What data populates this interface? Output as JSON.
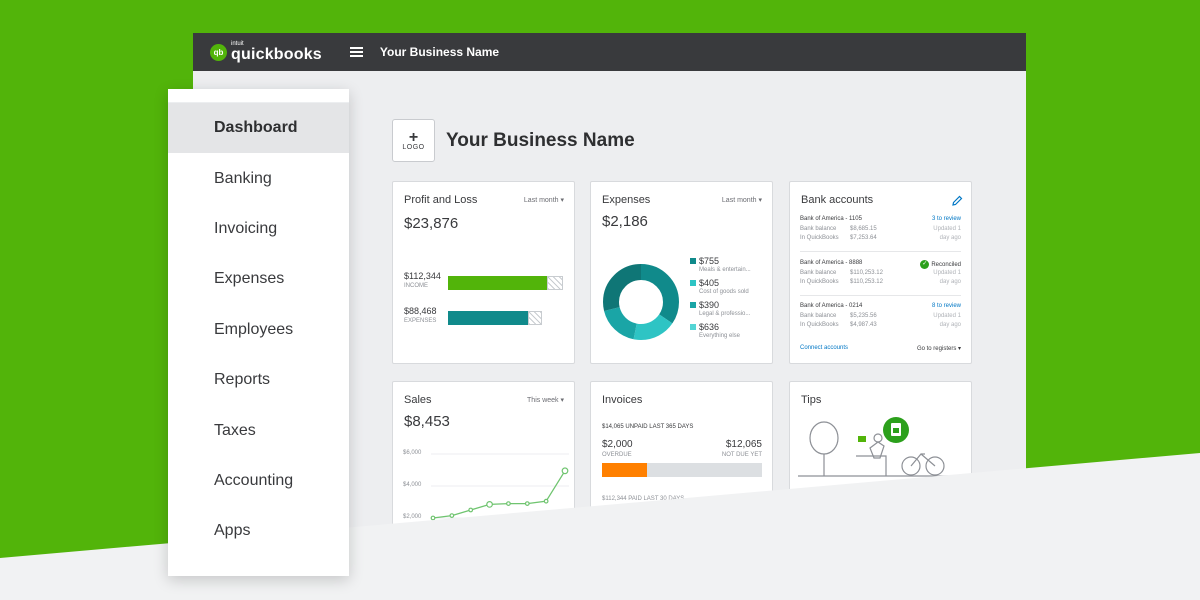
{
  "colors": {
    "brand_green": "#52b40a",
    "dark": "#393a3d",
    "teal": "#108a8b",
    "light_teal": "#2ec4c4",
    "orange": "#ff8000",
    "link_blue": "#0077c5"
  },
  "topbar": {
    "brand_small": "intuit",
    "brand": "quickbooks",
    "logo_icon": "qb",
    "company": "Your Business Name"
  },
  "header": {
    "logo_plus": "+",
    "logo_label": "LOGO",
    "business_name": "Your Business Name"
  },
  "sidebar": {
    "items": [
      {
        "label": "Dashboard",
        "active": true
      },
      {
        "label": "Banking"
      },
      {
        "label": "Invoicing"
      },
      {
        "label": "Expenses"
      },
      {
        "label": "Employees"
      },
      {
        "label": "Reports"
      },
      {
        "label": "Taxes"
      },
      {
        "label": "Accounting"
      },
      {
        "label": "Apps"
      }
    ]
  },
  "profit_loss": {
    "title": "Profit and Loss",
    "period": "Last month ▾",
    "amount": "$23,876",
    "income_value": "$112,344",
    "income_label": "INCOME",
    "expenses_value": "$88,468",
    "expenses_label": "EXPENSES",
    "income_fraction": 0.85,
    "expenses_fraction": 0.68
  },
  "expenses": {
    "title": "Expenses",
    "period": "Last month ▾",
    "amount": "$2,186",
    "legend": [
      {
        "value": "$755",
        "label": "Meals & entertain...",
        "color": "#108a8b"
      },
      {
        "value": "$405",
        "label": "Cost of goods sold",
        "color": "#2ec4c4"
      },
      {
        "value": "$390",
        "label": "Legal & professio...",
        "color": "#1aa5a6"
      },
      {
        "value": "$636",
        "label": "Everything else",
        "color": "#54d5d5"
      }
    ]
  },
  "bank": {
    "title": "Bank accounts",
    "edit_icon": "pencil-icon",
    "accounts": [
      {
        "name": "Bank of America - 1105",
        "status": "3 to review",
        "bank_label": "Bank balance",
        "bank_balance": "$8,685.15",
        "qb_label": "In QuickBooks",
        "qb_balance": "$7,253.64",
        "updated1": "Updated 1",
        "updated2": "day ago"
      },
      {
        "name": "Bank of America - 8888",
        "status": "Reconciled",
        "bank_label": "Bank balance",
        "bank_balance": "$110,253.12",
        "qb_label": "In QuickBooks",
        "qb_balance": "$110,253.12",
        "updated1": "Updated 1",
        "updated2": "day ago"
      },
      {
        "name": "Bank of America - 0214",
        "status": "8 to review",
        "bank_label": "Bank balance",
        "bank_balance": "$5,235.56",
        "qb_label": "In QuickBooks",
        "qb_balance": "$4,987.43",
        "updated1": "Updated 1",
        "updated2": "day ago"
      }
    ],
    "connect": "Connect accounts",
    "goto": "Go to registers ▾"
  },
  "sales": {
    "title": "Sales",
    "period": "This week ▾",
    "amount": "$8,453",
    "y_labels": [
      "$6,000",
      "$4,000",
      "$2,000"
    ]
  },
  "chart_data": {
    "type": "line",
    "title": "Sales",
    "ylim": [
      2000,
      6000
    ],
    "series": [
      {
        "values": [
          2000,
          2150,
          2500,
          2850,
          2900,
          2900,
          3050,
          4950
        ]
      }
    ]
  },
  "invoices": {
    "title": "Invoices",
    "unpaid_line": "$14,065 UNPAID LAST 365 DAYS",
    "overdue_value": "$2,000",
    "overdue_label": "OVERDUE",
    "notdue_value": "$12,065",
    "notdue_label": "NOT DUE YET",
    "overdue_fraction": 0.28,
    "paid_line": "$112,344 PAID LAST 30 DAYS"
  },
  "tips": {
    "title": "Tips",
    "badge_icon": "document-icon"
  }
}
